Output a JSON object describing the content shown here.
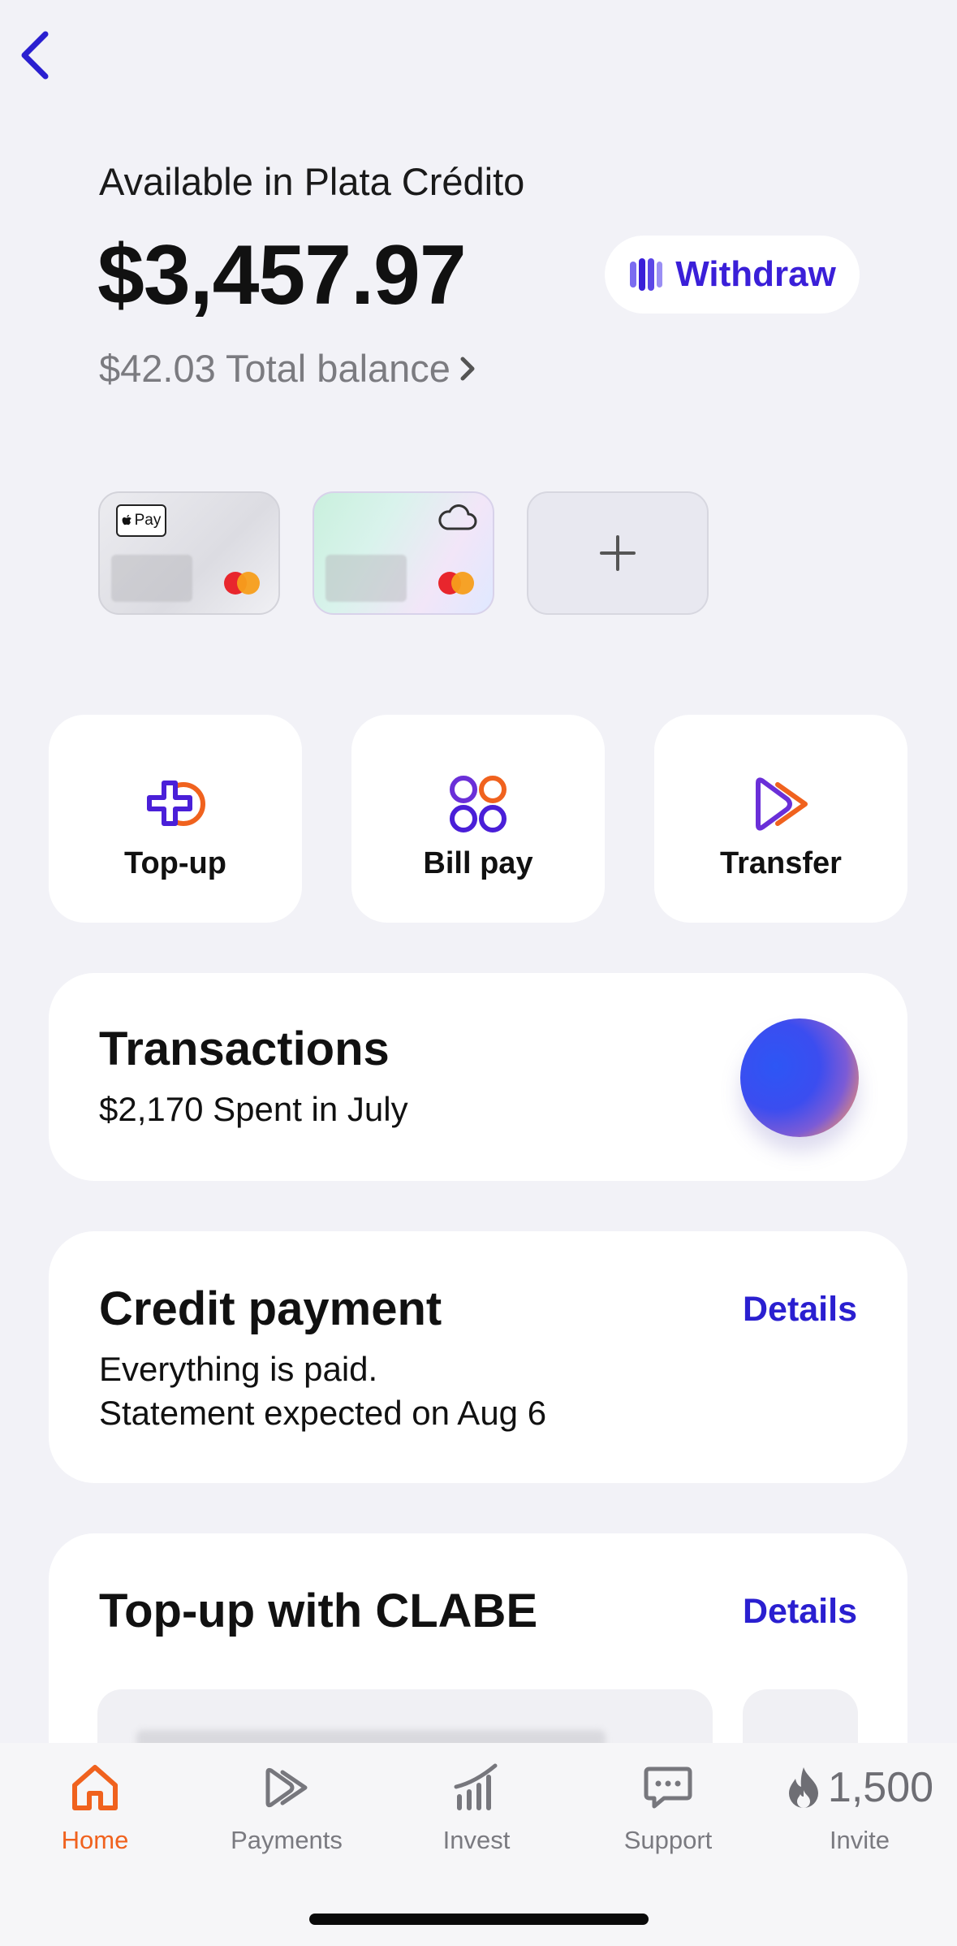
{
  "header": {
    "available_label": "Available in Plata Crédito",
    "available_amount": "$3,457.97",
    "withdraw_label": "Withdraw",
    "total_balance": "$42.03 Total balance"
  },
  "cards": {
    "apple_pay_label": "Pay"
  },
  "actions": [
    {
      "label": "Top-up"
    },
    {
      "label": "Bill pay"
    },
    {
      "label": "Transfer"
    }
  ],
  "transactions": {
    "title": "Transactions",
    "subtitle": "$2,170 Spent in July"
  },
  "credit_payment": {
    "title": "Credit payment",
    "details_label": "Details",
    "line1": "Everything is paid.",
    "line2": "Statement expected on Aug 6"
  },
  "clabe": {
    "title": "Top-up with CLABE",
    "details_label": "Details"
  },
  "tabbar": {
    "items": [
      {
        "label": "Home",
        "active": true
      },
      {
        "label": "Payments",
        "active": false
      },
      {
        "label": "Invest",
        "active": false
      },
      {
        "label": "Support",
        "active": false
      },
      {
        "label": "Invite",
        "active": false
      }
    ],
    "invite_points": "1,500"
  },
  "colors": {
    "accent": "#2a1fd0",
    "active_tab": "#f0621e",
    "background": "#f2f2f7"
  }
}
